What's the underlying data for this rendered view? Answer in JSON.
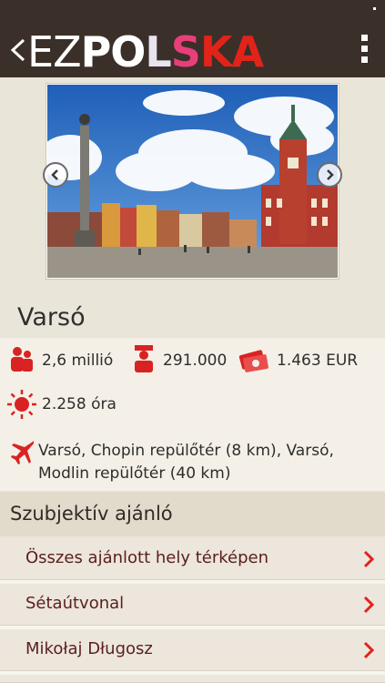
{
  "app": {
    "logo_ez": "EZ",
    "logo_po": "PO",
    "logo_l": "L",
    "logo_s": "S",
    "logo_ka": "KA",
    "brand_colors": {
      "header_bg": "#3b2f2a",
      "pink": "#e83f7a",
      "red": "#e2231a",
      "link": "#5a1e1e"
    }
  },
  "city": {
    "name": "Varsó",
    "population": "2,6 millió",
    "police_count": "291.000",
    "price": "1.463 EUR",
    "sunshine": "2.258 óra",
    "airports": "Varsó, Chopin repülőtér (8 km), Varsó, Modlin repülőtér (40 km)"
  },
  "recommender": {
    "title": "Szubjektív ajánló",
    "items": [
      {
        "label": "Összes ajánlott hely térképen"
      },
      {
        "label": "Sétaútvonal"
      },
      {
        "label": "Mikołaj Długosz"
      }
    ]
  },
  "icons": {
    "back": "chevron-left-icon",
    "menu": "vertical-dots-icon",
    "population": "people-icon",
    "police": "police-icon",
    "money": "money-icon",
    "sun": "sun-icon",
    "plane": "airplane-icon"
  }
}
